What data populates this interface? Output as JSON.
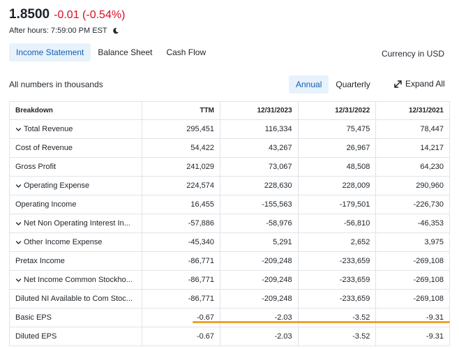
{
  "quote": {
    "price": "1.8500",
    "change": "-0.01 (-0.54%)",
    "after_hours": "After hours: 7:59:00 PM EST",
    "after_icon": "moon-icon"
  },
  "tabs": [
    {
      "label": "Income Statement",
      "active": true
    },
    {
      "label": "Balance Sheet",
      "active": false
    },
    {
      "label": "Cash Flow",
      "active": false
    }
  ],
  "currency": "Currency in USD",
  "units_note": "All numbers in thousands",
  "period_tabs": [
    {
      "label": "Annual",
      "active": true
    },
    {
      "label": "Quarterly",
      "active": false
    }
  ],
  "expand_all": "Expand All",
  "table": {
    "headers": [
      "Breakdown",
      "TTM",
      "12/31/2023",
      "12/31/2022",
      "12/31/2021"
    ],
    "rows": [
      {
        "label": "Total Revenue",
        "expandable": true,
        "values": [
          "295,451",
          "116,334",
          "75,475",
          "78,447"
        ]
      },
      {
        "label": "Cost of Revenue",
        "expandable": false,
        "values": [
          "54,422",
          "43,267",
          "26,967",
          "14,217"
        ]
      },
      {
        "label": "Gross Profit",
        "expandable": false,
        "values": [
          "241,029",
          "73,067",
          "48,508",
          "64,230"
        ]
      },
      {
        "label": "Operating Expense",
        "expandable": true,
        "values": [
          "224,574",
          "228,630",
          "228,009",
          "290,960"
        ]
      },
      {
        "label": "Operating Income",
        "expandable": false,
        "values": [
          "16,455",
          "-155,563",
          "-179,501",
          "-226,730"
        ]
      },
      {
        "label": "Net Non Operating Interest In...",
        "expandable": true,
        "values": [
          "-57,886",
          "-58,976",
          "-56,810",
          "-46,353"
        ]
      },
      {
        "label": "Other Income Expense",
        "expandable": true,
        "values": [
          "-45,340",
          "5,291",
          "2,652",
          "3,975"
        ]
      },
      {
        "label": "Pretax Income",
        "expandable": false,
        "values": [
          "-86,771",
          "-209,248",
          "-233,659",
          "-269,108"
        ]
      },
      {
        "label": "Net Income Common Stockho...",
        "expandable": true,
        "values": [
          "-86,771",
          "-209,248",
          "-233,659",
          "-269,108"
        ]
      },
      {
        "label": "Diluted NI Available to Com Stoc...",
        "expandable": false,
        "values": [
          "-86,771",
          "-209,248",
          "-233,659",
          "-269,108"
        ]
      },
      {
        "label": "Basic EPS",
        "expandable": false,
        "values": [
          "-0.67",
          "-2.03",
          "-3.52",
          "-9.31"
        ]
      },
      {
        "label": "Diluted EPS",
        "expandable": false,
        "values": [
          "-0.67",
          "-2.03",
          "-3.52",
          "-9.31"
        ]
      }
    ]
  },
  "colors": {
    "negative_change": "#d60a22",
    "active_tab_bg": "#e8f2fd",
    "active_tab_text": "#0f5eaf",
    "highlight": "#f0a226"
  }
}
